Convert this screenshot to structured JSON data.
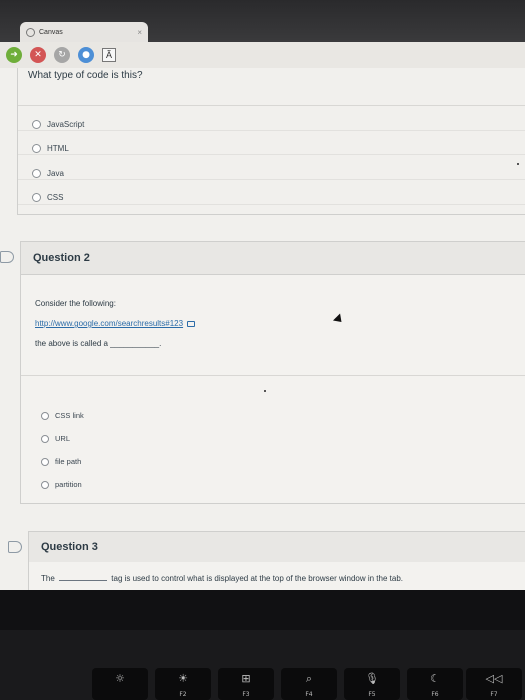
{
  "browser": {
    "tab_title": "Canvas",
    "tab_close": "×",
    "toolbar": {
      "back_icon": "arrow-right-icon",
      "stop_icon": "close-icon",
      "reload_icon": "reload-icon",
      "globe_icon": "globe-icon",
      "text_size_label": "Ã"
    }
  },
  "quiz": {
    "question1": {
      "prompt": "What type of code is this?",
      "answers": [
        "JavaScript",
        "HTML",
        "Java",
        "CSS"
      ]
    },
    "question2": {
      "title": "Question 2",
      "line1": "Consider the following:",
      "link": "http://www.google.com/searchresults#123",
      "line3_prefix": "the above is called a",
      "line3_blank": "___________.",
      "answers": [
        "CSS link",
        "URL",
        "file path",
        "partition"
      ]
    },
    "question3": {
      "title": "Question 3",
      "text_prefix": "The",
      "text_suffix": "tag is used to control what is displayed at the top of the browser window in the tab."
    }
  },
  "keyboard": {
    "keys": [
      {
        "glyph": "☼",
        "label": ""
      },
      {
        "glyph": "☀",
        "label": "F2"
      },
      {
        "glyph": "⊞",
        "label": "F3"
      },
      {
        "glyph": "⌕",
        "label": "F4"
      },
      {
        "glyph": "🎙",
        "label": "F5"
      },
      {
        "glyph": "☾",
        "label": "F6"
      },
      {
        "glyph": "◁◁",
        "label": "F7"
      }
    ]
  }
}
